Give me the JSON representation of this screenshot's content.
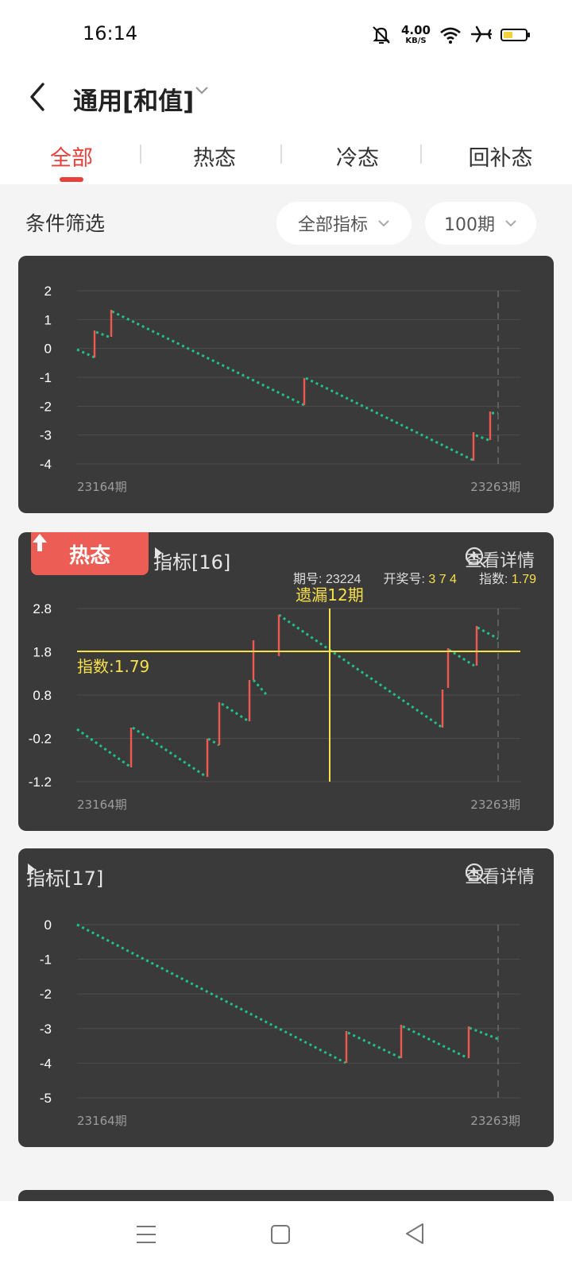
{
  "status": {
    "time": "16:14",
    "net_speed": "4.00",
    "net_unit": "KB/S"
  },
  "header": {
    "title": "通用[和值]"
  },
  "tabs": [
    {
      "label": "全部",
      "active": true
    },
    {
      "label": "热态",
      "active": false
    },
    {
      "label": "冷态",
      "active": false
    },
    {
      "label": "回补态",
      "active": false
    }
  ],
  "filter": {
    "label": "条件筛选",
    "indicator_select": "全部指标",
    "period_select": "100期"
  },
  "cards": [
    {
      "detail_label": "",
      "x_start": "23164期",
      "x_end": "23263期",
      "chart_data": {
        "type": "line",
        "x": [
          "23164期",
          "23263期"
        ],
        "yticks": [
          "2",
          "1",
          "0",
          "-1",
          "-2",
          "-3",
          "-4"
        ],
        "ylim": [
          -4,
          2
        ],
        "grid": true,
        "trend_color": "#1fc28a",
        "jump_color": "#ee5a52"
      }
    },
    {
      "badge": "热态",
      "indicator": "指标[16]",
      "detail_label": "查看详情",
      "info": {
        "issue_label": "期号:",
        "issue": "23224",
        "draw_label": "开奖号:",
        "draw": "3 7 4",
        "index_label": "指数:",
        "index": "1.79"
      },
      "crosshair_label": "遗漏12期",
      "index_line_label": "指数:1.79",
      "x_start": "23164期",
      "x_end": "23263期",
      "chart_data": {
        "type": "line",
        "x": [
          "23164期",
          "23263期"
        ],
        "yticks": [
          "2.8",
          "1.8",
          "0.8",
          "-0.2",
          "-1.2"
        ],
        "ylim": [
          -1.2,
          2.8
        ],
        "grid": true,
        "reference_value": 1.79,
        "reference_color": "#f7e04a",
        "trend_color": "#1fc28a",
        "jump_color": "#ee5a52"
      }
    },
    {
      "indicator": "指标[17]",
      "detail_label": "查看详情",
      "x_start": "23164期",
      "x_end": "23263期",
      "chart_data": {
        "type": "line",
        "x": [
          "23164期",
          "23263期"
        ],
        "yticks": [
          "0",
          "-1",
          "-2",
          "-3",
          "-4",
          "-5"
        ],
        "ylim": [
          -5,
          0
        ],
        "grid": true,
        "trend_color": "#1fc28a",
        "jump_color": "#ee5a52"
      }
    }
  ]
}
